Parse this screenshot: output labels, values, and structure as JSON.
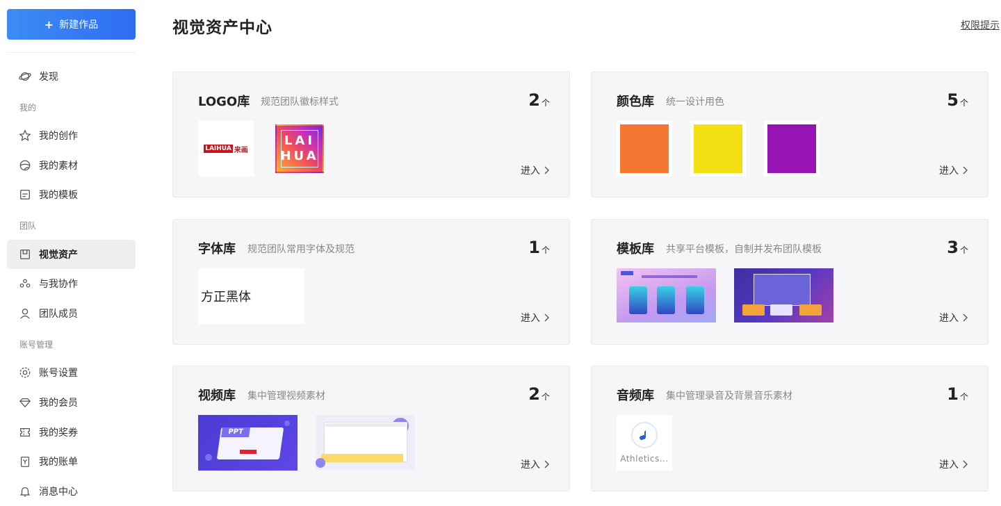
{
  "sidebar": {
    "new_button": "新建作品",
    "discover": "发现",
    "sections": {
      "mine": "我的",
      "team": "团队",
      "account": "账号管理"
    },
    "items": {
      "my_creations": "我的创作",
      "my_materials": "我的素材",
      "my_templates": "我的模板",
      "visual_assets": "视觉资产",
      "collab_with_me": "与我协作",
      "team_members": "团队成员",
      "account_settings": "账号设置",
      "my_membership": "我的会员",
      "my_coupons": "我的奖券",
      "my_bills": "我的账单",
      "message_center": "消息中心"
    },
    "active": "visual_assets"
  },
  "header": {
    "title": "视觉资产中心",
    "hint_link": "权限提示"
  },
  "cards": {
    "logo": {
      "title": "LOGO库",
      "desc": "规范团队徽标样式",
      "count": "2",
      "unit": "个",
      "enter": "进入",
      "logos": [
        {
          "mark": "LAIHUA",
          "text": "来画"
        },
        {
          "line1": "LAI",
          "line2": "HUA"
        }
      ]
    },
    "color": {
      "title": "颜色库",
      "desc": "统一设计用色",
      "count": "5",
      "unit": "个",
      "enter": "进入",
      "swatches": [
        "#f57731",
        "#f2e012",
        "#9614b3"
      ]
    },
    "font": {
      "title": "字体库",
      "desc": "规范团队常用字体及规范",
      "count": "1",
      "unit": "个",
      "enter": "进入",
      "font_name": "方正黑体"
    },
    "template": {
      "title": "模板库",
      "desc": "共享平台模板，自制并发布团队模板",
      "count": "3",
      "unit": "个",
      "enter": "进入"
    },
    "video": {
      "title": "视频库",
      "desc": "集中管理视频素材",
      "count": "2",
      "unit": "个",
      "enter": "进入",
      "ppt_label": "PPT"
    },
    "audio": {
      "title": "音频库",
      "desc": "集中管理录音及背景音乐素材",
      "count": "1",
      "unit": "个",
      "enter": "进入",
      "audio_name": "Athletics..."
    }
  },
  "icons": {
    "discover": "planet-icon",
    "my_creations": "star-icon",
    "my_materials": "palette-icon",
    "my_templates": "folder-icon",
    "visual_assets": "asset-box-icon",
    "collab_with_me": "people-icon",
    "team_members": "user-icon",
    "account_settings": "gear-icon",
    "my_membership": "diamond-icon",
    "my_coupons": "ticket-icon",
    "my_bills": "bill-icon",
    "message_center": "bell-icon"
  },
  "colors": {
    "primary_button": "#3c8cf5",
    "card_bg": "#f6f6f9"
  }
}
